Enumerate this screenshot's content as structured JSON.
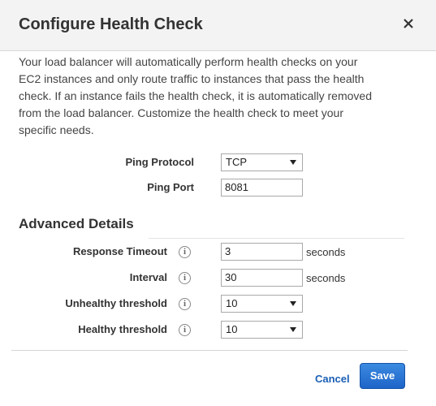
{
  "dialog": {
    "title": "Configure Health Check",
    "description": "Your load balancer will automatically perform health checks on your EC2 instances and only route traffic to instances that pass the health check. If an instance fails the health check, it is automatically removed from the load balancer. Customize the health check to meet your specific needs."
  },
  "ping": {
    "protocol_label": "Ping Protocol",
    "protocol_value": "TCP",
    "port_label": "Ping Port",
    "port_value": "8081"
  },
  "advanced": {
    "title": "Advanced Details",
    "response_timeout_label": "Response Timeout",
    "response_timeout_value": "3",
    "response_timeout_unit": "seconds",
    "interval_label": "Interval",
    "interval_value": "30",
    "interval_unit": "seconds",
    "unhealthy_label": "Unhealthy threshold",
    "unhealthy_value": "10",
    "healthy_label": "Healthy threshold",
    "healthy_value": "10",
    "info_glyph": "i"
  },
  "footer": {
    "cancel_label": "Cancel",
    "save_label": "Save"
  },
  "icons": {
    "close": "close-icon",
    "info": "info-icon",
    "dropdown": "chevron-down-icon"
  },
  "colors": {
    "header_bg": "#f3f3f3",
    "link": "#1a5fb4",
    "primary_button": "#1e64c8"
  }
}
